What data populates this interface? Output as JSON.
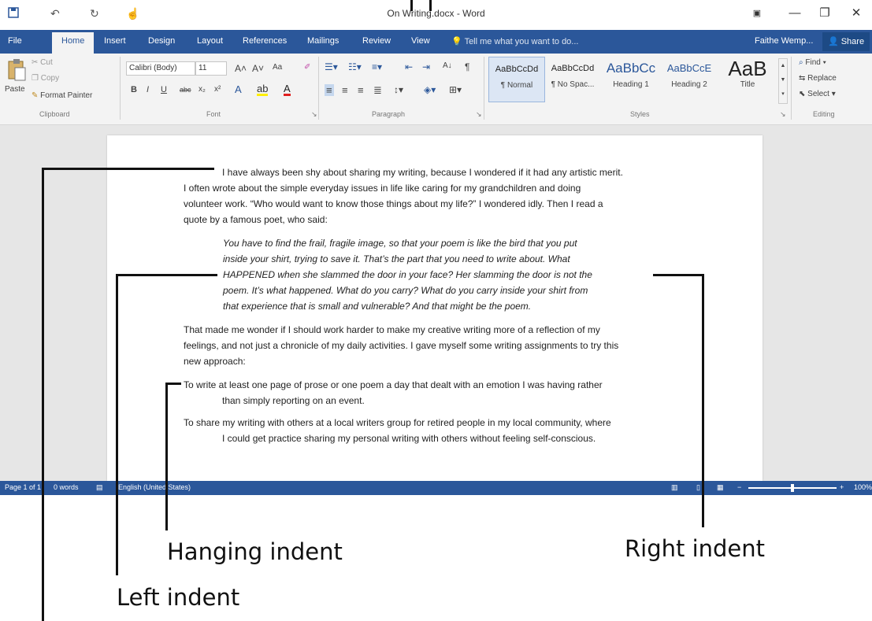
{
  "titlebar": {
    "title": "On Writing.docx - Word",
    "save_icon": "save-icon",
    "undo_icon": "undo-icon",
    "redo_icon": "redo-icon",
    "touch_icon": "touch-mode-icon",
    "controls": [
      "minimize-icon",
      "restore-icon",
      "close-icon"
    ]
  },
  "tabs": {
    "items": [
      "File",
      "Home",
      "Insert",
      "Design",
      "Layout",
      "References",
      "Mailings",
      "Review",
      "View"
    ],
    "active": "Home",
    "tell_me": "Tell me what you want to do...",
    "user": "Faithe Wemp...",
    "share": "Share"
  },
  "ribbon": {
    "clipboard": {
      "paste": "Paste",
      "cut": "Cut",
      "copy": "Copy",
      "format_painter": "Format Painter",
      "label": "Clipboard"
    },
    "font": {
      "family": "Calibri (Body)",
      "size": "11",
      "change_case": "Aa",
      "bold": "B",
      "italic": "I",
      "underline": "U",
      "strike": "abc",
      "subscript": "x₂",
      "superscript": "x²",
      "label": "Font"
    },
    "paragraph": {
      "sort": "A↓",
      "pilcrow": "¶",
      "label": "Paragraph"
    },
    "styles": {
      "label": "Styles",
      "items": [
        {
          "sample": "AaBbCcDd",
          "name": "¶ Normal"
        },
        {
          "sample": "AaBbCcDd",
          "name": "¶ No Spac..."
        },
        {
          "sample": "AaBbCc",
          "name": "Heading 1"
        },
        {
          "sample": "AaBbCcE",
          "name": "Heading 2"
        },
        {
          "sample": "AaB",
          "name": "Title"
        }
      ]
    },
    "editing": {
      "find": "Find",
      "replace": "Replace",
      "select": "Select",
      "label": "Editing"
    }
  },
  "document": {
    "para1": [
      "I have always been shy about sharing my writing, because I wondered if it had any artistic merit.",
      "I often wrote about the simple everyday issues in life like caring for my grandchildren and doing",
      "volunteer work. “Who would want to know those things about my life?” I wondered idly. Then I read a",
      "quote by a famous poet, who said:"
    ],
    "quote": [
      "You have to find the frail, fragile image, so that your poem is like the bird that you put",
      "inside your shirt, trying to save it. That’s the part that you need to write about. What",
      "HAPPENED when she slammed the door in your face? Her slamming the door is not the",
      "poem. It’s what happened. What do you carry? What do you carry inside your shirt from",
      "that experience that is small and vulnerable? And that might be the poem."
    ],
    "para2": [
      "That made me wonder if I should work harder to make my creative writing more of a reflection of my",
      "feelings, and not just a chronicle of my daily activities. I gave myself some writing assignments to try this",
      "new approach:"
    ],
    "item1": [
      "To write at least one page of prose or one poem a day that dealt with an emotion I was having rather",
      "than simply reporting on an event."
    ],
    "item2": [
      "To share my writing with others at a local writers group for retired people in my local community, where",
      "I could get practice sharing my personal writing with others without feeling self-conscious."
    ]
  },
  "status": {
    "page": "Page 1 of 1",
    "words": "0 words",
    "language": "English (United States)",
    "zoom": "100%"
  },
  "callouts": {
    "hanging": "Hanging indent",
    "right": "Right indent",
    "left": "Left indent"
  }
}
